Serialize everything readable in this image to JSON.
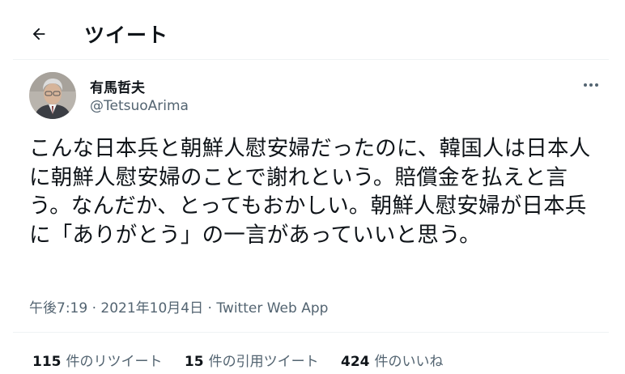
{
  "header": {
    "back_icon": "arrow-left-icon",
    "title": "ツイート"
  },
  "tweet": {
    "author_name": "有馬哲夫",
    "author_handle": "@TetsuoArima",
    "more_icon": "more-horizontal-icon",
    "text": "こんな日本兵と朝鮮人慰安婦だったのに、韓国人は日本人に朝鮮人慰安婦のことで謝れという。賠償金を払えと言う。なんだか、とってもおかしい。朝鮮人慰安婦が日本兵に「ありがとう」の一言があっていいと思う。",
    "time": "午後7:19",
    "date": "2021年10月4日",
    "separator": "·",
    "source": "Twitter Web App"
  },
  "stats": [
    {
      "count": "115",
      "label": "件のリツイート"
    },
    {
      "count": "15",
      "label": "件の引用ツイート"
    },
    {
      "count": "424",
      "label": "件のいいね"
    }
  ],
  "colors": {
    "text_primary": "#0f1419",
    "text_secondary": "#536471",
    "divider": "#eff3f4"
  }
}
